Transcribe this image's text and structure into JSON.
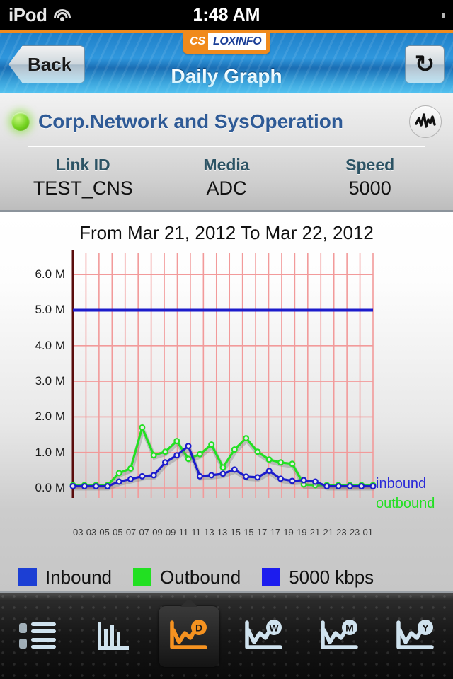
{
  "status_bar": {
    "device": "iPod",
    "wifi_icon": "wifi-icon",
    "time": "1:48 AM",
    "battery_icon": "battery-charging-icon"
  },
  "nav": {
    "back_label": "Back",
    "title": "Daily Graph",
    "refresh_icon": "refresh-icon",
    "logo_primary": "CS",
    "logo_secondary": "LOXINFO"
  },
  "info": {
    "status_indicator": "status-led-green",
    "device_name": "Corp.Network and SysOperation",
    "wave_icon": "waveform-icon",
    "columns": [
      {
        "header": "Link ID",
        "value": "TEST_CNS"
      },
      {
        "header": "Media",
        "value": "ADC"
      },
      {
        "header": "Speed",
        "value": "5000"
      }
    ]
  },
  "chart_data": {
    "type": "line",
    "title": "From Mar 21, 2012 To Mar 22, 2012",
    "xlabel": "",
    "ylabel": "",
    "ylim": [
      0,
      6.6
    ],
    "yticks": [
      0,
      1,
      2,
      3,
      4,
      5,
      6
    ],
    "ytick_labels": [
      "0.0 M",
      "1.0 M",
      "2.0 M",
      "3.0 M",
      "4.0 M",
      "5.0 M",
      "6.0 M"
    ],
    "grid": true,
    "grid_color": "#f29a9a",
    "axis_color": "#5a0c0c",
    "legend_position": "below",
    "x": [
      "03",
      "03",
      "05",
      "05",
      "07",
      "07",
      "09",
      "09",
      "11",
      "11",
      "13",
      "13",
      "15",
      "15",
      "17",
      "17",
      "19",
      "19",
      "21",
      "21",
      "23",
      "23",
      "01"
    ],
    "series": [
      {
        "name": "Inbound",
        "color": "#1c1ccc",
        "marker": "open-circle",
        "values": [
          0.05,
          0.05,
          0.05,
          0.05,
          0.18,
          0.25,
          0.33,
          0.36,
          0.72,
          0.92,
          1.18,
          0.33,
          0.36,
          0.4,
          0.52,
          0.32,
          0.3,
          0.48,
          0.26,
          0.2,
          0.22,
          0.18,
          0.05,
          0.05,
          0.05,
          0.05,
          0.05
        ]
      },
      {
        "name": "Outbound",
        "color": "#22e022",
        "marker": "open-circle",
        "values": [
          0.08,
          0.08,
          0.08,
          0.08,
          0.42,
          0.55,
          1.7,
          0.92,
          1.02,
          1.32,
          0.82,
          0.95,
          1.22,
          0.58,
          1.08,
          1.4,
          1.02,
          0.8,
          0.72,
          0.68,
          0.1,
          0.08,
          0.08,
          0.08,
          0.08,
          0.08,
          0.08
        ]
      },
      {
        "name": "5000 kbps",
        "color": "#1c1ccc",
        "marker": "none",
        "type": "threshold",
        "value": 5.0
      }
    ],
    "annotations": [
      {
        "text": "inbound",
        "color": "#2a2ad8"
      },
      {
        "text": "outbound",
        "color": "#22e022"
      }
    ],
    "legend": [
      {
        "label": "Inbound",
        "color": "#1c3fd4"
      },
      {
        "label": "Outbound",
        "color": "#22e022"
      },
      {
        "label": "5000 kbps",
        "color": "#1c1cee"
      }
    ]
  },
  "toolbar": {
    "items": [
      {
        "name": "list",
        "icon": "list-icon",
        "badge": "",
        "active": false
      },
      {
        "name": "bar",
        "icon": "bar-chart-icon",
        "badge": "",
        "active": false
      },
      {
        "name": "daily",
        "icon": "line-chart-icon",
        "badge": "D",
        "active": true
      },
      {
        "name": "weekly",
        "icon": "line-chart-icon",
        "badge": "W",
        "active": false
      },
      {
        "name": "monthly",
        "icon": "line-chart-icon",
        "badge": "M",
        "active": false
      },
      {
        "name": "yearly",
        "icon": "line-chart-icon",
        "badge": "Y",
        "active": false
      }
    ]
  }
}
